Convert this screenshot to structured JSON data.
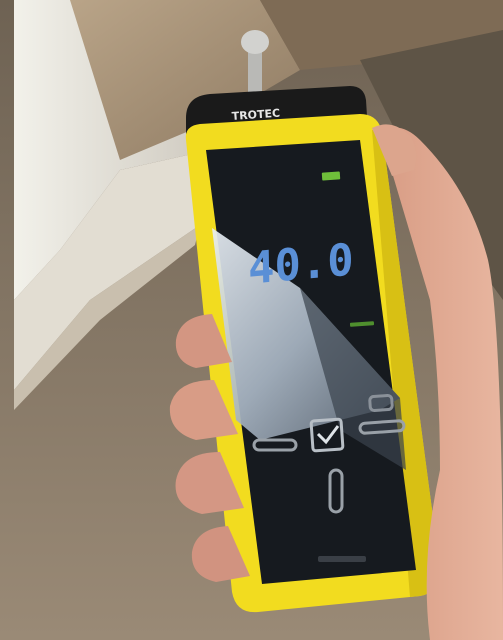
{
  "device": {
    "brand": "TROTEC",
    "reading": "40.0",
    "footer_text": "",
    "colors": {
      "case_yellow": "#f2dc1f",
      "screen_dark": "#161a1f",
      "digits_blue": "#5a8fd6",
      "indicator_green": "#6fbf3a",
      "wall_white": "#e9e8e0",
      "carpet": "#8a7a68"
    },
    "icons": [
      "battery-icon",
      "left-bar-icon",
      "check-box-icon",
      "right-bar-icon",
      "down-bar-icon",
      "up-arrow-icon"
    ]
  }
}
